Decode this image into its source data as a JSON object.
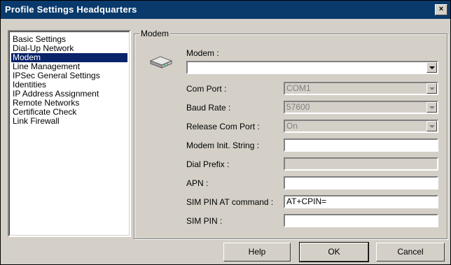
{
  "window": {
    "title": "Profile Settings   Headquarters",
    "close_label": "×"
  },
  "nav": {
    "items": [
      {
        "label": "Basic Settings",
        "selected": false
      },
      {
        "label": "Dial-Up Network",
        "selected": false
      },
      {
        "label": "Modem",
        "selected": true
      },
      {
        "label": "Line Management",
        "selected": false
      },
      {
        "label": "IPSec General Settings",
        "selected": false
      },
      {
        "label": "Identities",
        "selected": false
      },
      {
        "label": "IP Address Assignment",
        "selected": false
      },
      {
        "label": "Remote Networks",
        "selected": false
      },
      {
        "label": "Certificate Check",
        "selected": false
      },
      {
        "label": "Link Firewall",
        "selected": false
      }
    ]
  },
  "modem_group": {
    "label": "Modem",
    "modem_label": "Modem :",
    "modem_value": "",
    "com_port_label": "Com Port :",
    "com_port_value": "COM1",
    "baud_rate_label": "Baud Rate :",
    "baud_rate_value": "57600",
    "release_label": "Release Com Port :",
    "release_value": "On",
    "init_label": "Modem Init. String :",
    "init_value": "",
    "dial_prefix_label": "Dial Prefix :",
    "dial_prefix_value": "",
    "apn_label": "APN :",
    "apn_value": "",
    "sim_pin_at_label": "SIM PIN AT command :",
    "sim_pin_at_value": "AT+CPIN=",
    "sim_pin_label": "SIM PIN :",
    "sim_pin_value": ""
  },
  "buttons": {
    "help": "Help",
    "ok": "OK",
    "cancel": "Cancel"
  }
}
